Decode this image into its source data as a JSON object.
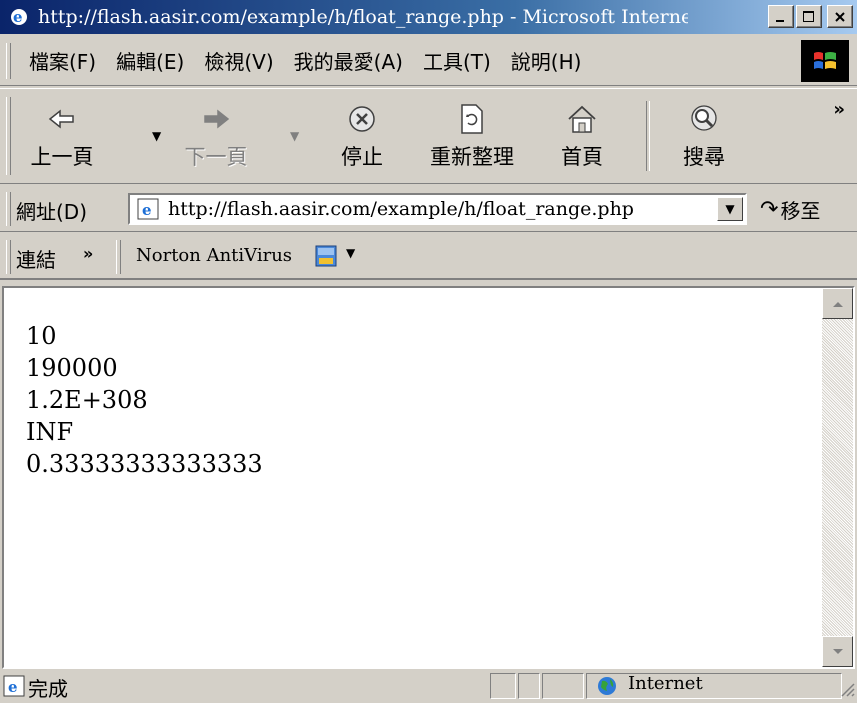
{
  "window": {
    "title": "http://flash.aasir.com/example/h/float_range.php - Microsoft Internet Exp..."
  },
  "menu": {
    "items": [
      "檔案(F)",
      "編輯(E)",
      "檢視(V)",
      "我的最愛(A)",
      "工具(T)",
      "說明(H)"
    ]
  },
  "toolbar": {
    "back_label": "上一頁",
    "forward_label": "下一頁",
    "stop_label": "停止",
    "refresh_label": "重新整理",
    "home_label": "首頁",
    "search_label": "搜尋"
  },
  "address": {
    "label": "網址(D)",
    "url": "http://flash.aasir.com/example/h/float_range.php",
    "go_label": "移至"
  },
  "links": {
    "label": "連結",
    "norton_label": "Norton AntiVirus"
  },
  "content": {
    "lines": [
      "10",
      "190000",
      "1.2E+308",
      "INF",
      "0.33333333333333"
    ]
  },
  "status": {
    "text": "完成",
    "zone": "Internet"
  },
  "colors": {
    "titlebar_start": "#0a246a",
    "titlebar_end": "#a6caf0",
    "chrome": "#d4d0c8"
  }
}
